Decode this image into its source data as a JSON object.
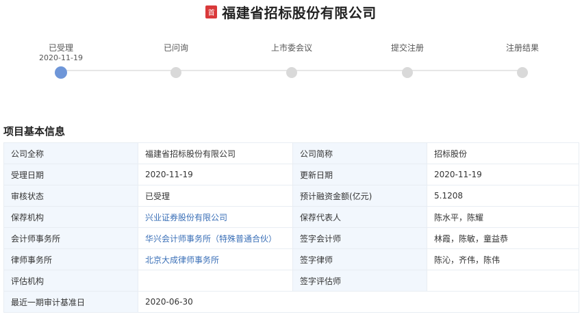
{
  "header": {
    "badge": "首",
    "company_name": "福建省招标股份有限公司"
  },
  "timeline": {
    "steps": [
      {
        "label": "已受理",
        "date": "2020-11-19",
        "active": true
      },
      {
        "label": "已问询",
        "date": "",
        "active": false
      },
      {
        "label": "上市委会议",
        "date": "",
        "active": false
      },
      {
        "label": "提交注册",
        "date": "",
        "active": false
      },
      {
        "label": "注册结果",
        "date": "",
        "active": false
      }
    ]
  },
  "section": {
    "title": "项目基本信息"
  },
  "info": {
    "full_name_label": "公司全称",
    "full_name": "福建省招标股份有限公司",
    "short_name_label": "公司简称",
    "short_name": "招标股份",
    "accept_date_label": "受理日期",
    "accept_date": "2020-11-19",
    "update_date_label": "更新日期",
    "update_date": "2020-11-19",
    "status_label": "审核状态",
    "status": "已受理",
    "amount_label": "预计融资金额(亿元)",
    "amount": "5.1208",
    "sponsor_label": "保荐机构",
    "sponsor": "兴业证券股份有限公司",
    "sponsor_rep_label": "保荐代表人",
    "sponsor_rep": "陈水平，陈耀",
    "accounting_firm_label": "会计师事务所",
    "accounting_firm": "华兴会计师事务所（特殊普通合伙）",
    "accountant_label": "签字会计师",
    "accountant": "林霞，陈敏，童益恭",
    "law_firm_label": "律师事务所",
    "law_firm": "北京大成律师事务所",
    "lawyer_label": "签字律师",
    "lawyer": "陈沁，齐伟，陈伟",
    "valuation_label": "评估机构",
    "valuation": "",
    "valuer_label": "签字评估师",
    "valuer": "",
    "audit_date_label": "最近一期审计基准日",
    "audit_date": "2020-06-30"
  }
}
